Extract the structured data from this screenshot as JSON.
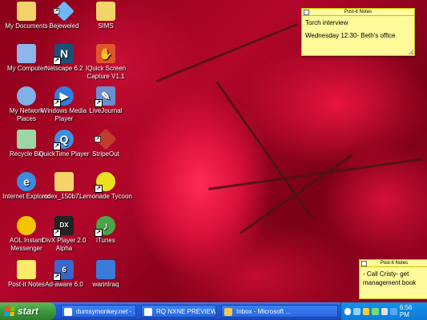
{
  "desktop": {
    "icons": [
      {
        "label": "My Documents",
        "glyph": "folder-icon",
        "color": "#f4d36b"
      },
      {
        "label": "My Computer",
        "glyph": "computer-icon",
        "color": "#8fb6ea"
      },
      {
        "label": "My Network Places",
        "glyph": "network-icon",
        "color": "#7fb0e6"
      },
      {
        "label": "Recycle Bin",
        "glyph": "recycle-bin-icon",
        "color": "#9ed4a6"
      },
      {
        "label": "Internet Explorer",
        "glyph": "ie-icon",
        "color": "#3b8de0"
      },
      {
        "label": "AOL Instant Messenger",
        "glyph": "aim-icon",
        "color": "#f5c400"
      },
      {
        "label": "Post-it Notes",
        "glyph": "postit-icon",
        "color": "#ffe96a"
      },
      {
        "label": "Bejeweled",
        "glyph": "gem-icon",
        "color": "#6fb7ff"
      },
      {
        "label": "Netscape 6.2",
        "glyph": "netscape-icon",
        "color": "#1b4f7a"
      },
      {
        "label": "Windows Media Player",
        "glyph": "media-player-icon",
        "color": "#2f7de1"
      },
      {
        "label": "QuickTime Player",
        "glyph": "quicktime-icon",
        "color": "#3d8fe3"
      },
      {
        "label": "cdex_150b7...",
        "glyph": "folder-icon",
        "color": "#f4d36b"
      },
      {
        "label": "DivX Player 2.0 Alpha",
        "glyph": "divx-icon",
        "color": "#222222"
      },
      {
        "label": "Ad-aware 6.0",
        "glyph": "adaware-icon",
        "color": "#3a66c8"
      },
      {
        "label": "SIMS",
        "glyph": "folder-icon",
        "color": "#f4d36b"
      },
      {
        "label": "IQuick Screen Capture V1.1",
        "glyph": "hand-icon",
        "color": "#e0542a"
      },
      {
        "label": "LiveJournal",
        "glyph": "pencil-icon",
        "color": "#6a8ecf"
      },
      {
        "label": "StripeOut",
        "glyph": "stripeout-icon",
        "color": "#c23b2b"
      },
      {
        "label": "Lemonade Tycoon",
        "glyph": "lemon-icon",
        "color": "#e8e022"
      },
      {
        "label": "iTunes",
        "glyph": "itunes-icon",
        "color": "#4aa548"
      },
      {
        "label": "warinIraq",
        "glyph": "app-icon",
        "color": "#3a7ad8"
      }
    ]
  },
  "notes": [
    {
      "brand": "Post-it Notes",
      "lines": [
        "Torch interview",
        "Wednesday 12:30- Beth's office"
      ]
    },
    {
      "brand": "Post-it Notes",
      "lines": [
        "- Call Cristy- get management book"
      ]
    }
  ],
  "taskbar": {
    "start_label": "start",
    "tasks": [
      {
        "label": "dumsymonkey.net - ...",
        "icon": "browser-icon"
      },
      {
        "label": "RQ NXNE PREVIEW - ...",
        "icon": "browser-icon"
      },
      {
        "label": "Inbox - Microsoft ...",
        "icon": "outlook-icon"
      }
    ],
    "clock": "6:56 PM"
  }
}
